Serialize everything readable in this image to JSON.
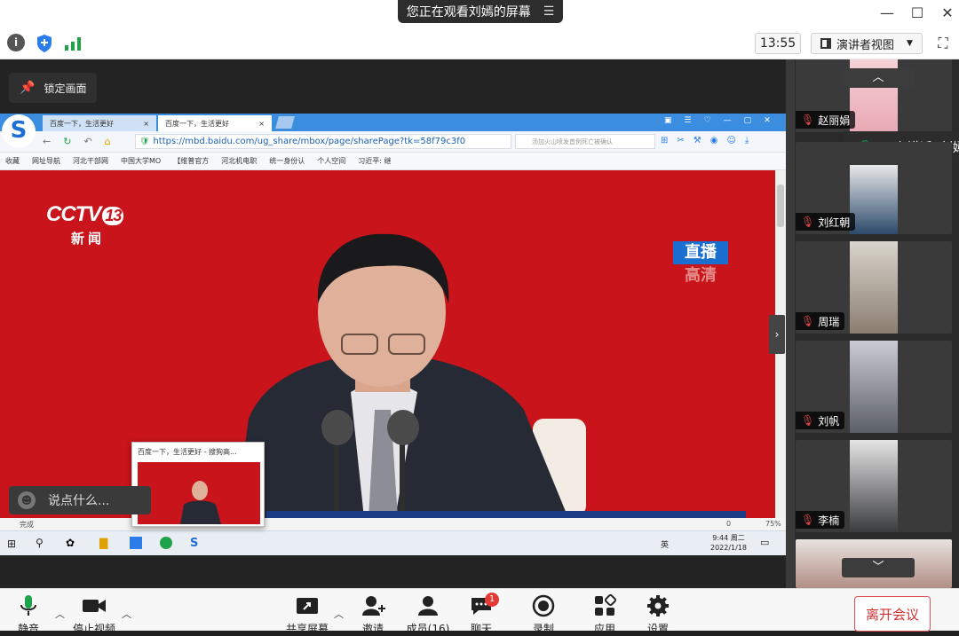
{
  "window": {
    "share_banner": "您正在观看刘嫣的屏幕",
    "clock": "13:55",
    "view_mode": "演讲者视图"
  },
  "stage": {
    "lock_label": "锁定画面",
    "chat_placeholder": "说点什么..."
  },
  "browser": {
    "tabs": [
      "百度一下，生活更好",
      "百度一下，生活更好"
    ],
    "url": "https://mbd.baidu.com/ug_share/mbox/page/sharePage?tk=58f79c3f0",
    "search_hint": "汤加火山喷发首例死亡被确认",
    "bookmarks": [
      "收藏",
      "网址导航",
      "河北干部网",
      "中国大学MO",
      "【维普官方",
      "河北机电职",
      "统一身份认",
      "个人空间",
      "习近平: 继"
    ],
    "status_left": "完成",
    "status_right": "75%",
    "status_zero": "0",
    "thumb_title": "百度一下，生活更好 - 搜狗高...",
    "taskbar_time": "9:44 周二",
    "taskbar_date": "2022/1/18",
    "taskbar_lang": "英"
  },
  "video": {
    "channel": "CCTV",
    "channel_num": "13",
    "channel_sub": "新闻",
    "live_top": "直播",
    "live_bottom": "高清"
  },
  "participants": [
    {
      "name": "赵丽娟"
    },
    {
      "name": "刘红朝"
    },
    {
      "name": "周瑞"
    },
    {
      "name": "刘帆"
    },
    {
      "name": "李楠"
    }
  ],
  "speaking_label": "正在讲话: 刘嫣",
  "toolbar": {
    "mute": "静音",
    "stop_video": "停止视频",
    "share": "共享屏幕",
    "invite": "邀请",
    "members": "成员(16)",
    "chat": "聊天",
    "chat_badge": "1",
    "record": "录制",
    "apps": "应用",
    "settings": "设置",
    "leave": "离开会议"
  },
  "colors": {
    "cctv_red": "#c8141a",
    "browser_blue": "#3b8de0",
    "leave_red": "#d03030",
    "mic_green": "#1fa34a"
  }
}
